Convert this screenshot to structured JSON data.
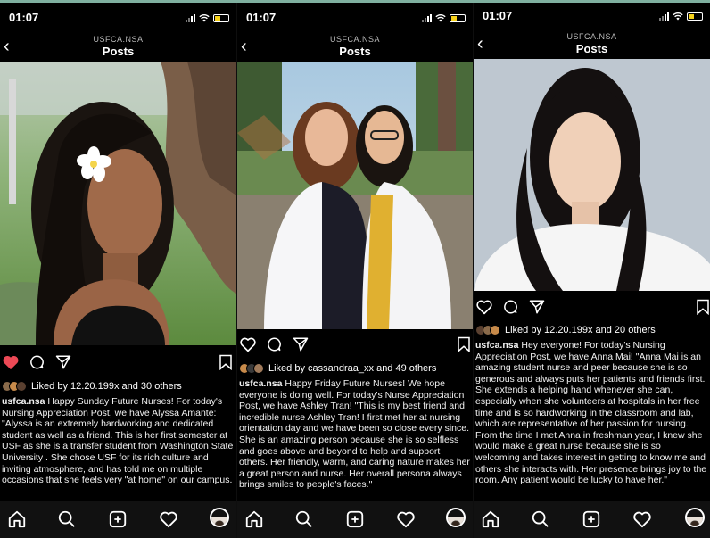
{
  "panels": [
    {
      "time": "01:07",
      "account": "USFCA.NSA",
      "title": "Posts",
      "liked_by": "Liked by 12.20.199x and 30 others",
      "caption_user": "usfca.nsa",
      "caption_text": "Happy Sunday Future Nurses! For today's Nursing Appreciation Post, we have Alyssa Amante: \"Alyssa is an extremely hardworking and dedicated student as well as a friend. This is her first semester at USF as she is a transfer student from Washington State University . She chose USF for its rich culture and inviting atmosphere, and has told me on multiple occasions that she feels very \"at home\" on our campus.",
      "heart_liked": true
    },
    {
      "time": "01:07",
      "account": "USFCA.NSA",
      "title": "Posts",
      "liked_by": "Liked by cassandraa_xx and 49 others",
      "caption_user": "usfca.nsa",
      "caption_text": "Happy Friday Future Nurses! We hope everyone is doing well. For today's Nurse Appreciation Post, we have Ashley Tran! \"This is my best friend and incredible nurse Ashley Tran! I first met her at nursing orientation day and we have been so close every since. She is an amazing person because she is so selfless and goes above and beyond to help and support others. Her friendly, warm, and caring nature makes her a great person and nurse. Her overall persona always brings smiles to people's faces.\"",
      "heart_liked": false
    },
    {
      "time": "01:07",
      "account": "USFCA.NSA",
      "title": "Posts",
      "liked_by": "Liked by 12.20.199x and 20 others",
      "caption_user": "usfca.nsa",
      "caption_text": "Hey everyone! For today's Nursing Appreciation Post, we have Anna Mai! \"Anna Mai is an amazing student nurse and peer because she is so generous and always puts her patients and friends first. She extends a helping hand whenever she can, especially when she volunteers at hospitals in her free time and is so hardworking in the classroom and lab, which are representative of her passion for nursing. From the time I met Anna in freshman year, I knew she would make a great nurse because she is so welcoming and takes interest in getting to know me and others she interacts with. Her presence brings joy to the room. Any patient would be lucky to have her.\"",
      "heart_liked": false
    }
  ],
  "icons": {
    "back": "chevron-left-icon",
    "like": "heart-icon",
    "comment": "comment-icon",
    "share": "send-icon",
    "save": "bookmark-icon",
    "nav": [
      "home-icon",
      "search-icon",
      "add-post-icon",
      "activity-heart-icon",
      "profile-avatar"
    ]
  },
  "colors": {
    "background": "#000000",
    "liked_heart": "#ed4956",
    "battery": "#f6d21b"
  }
}
